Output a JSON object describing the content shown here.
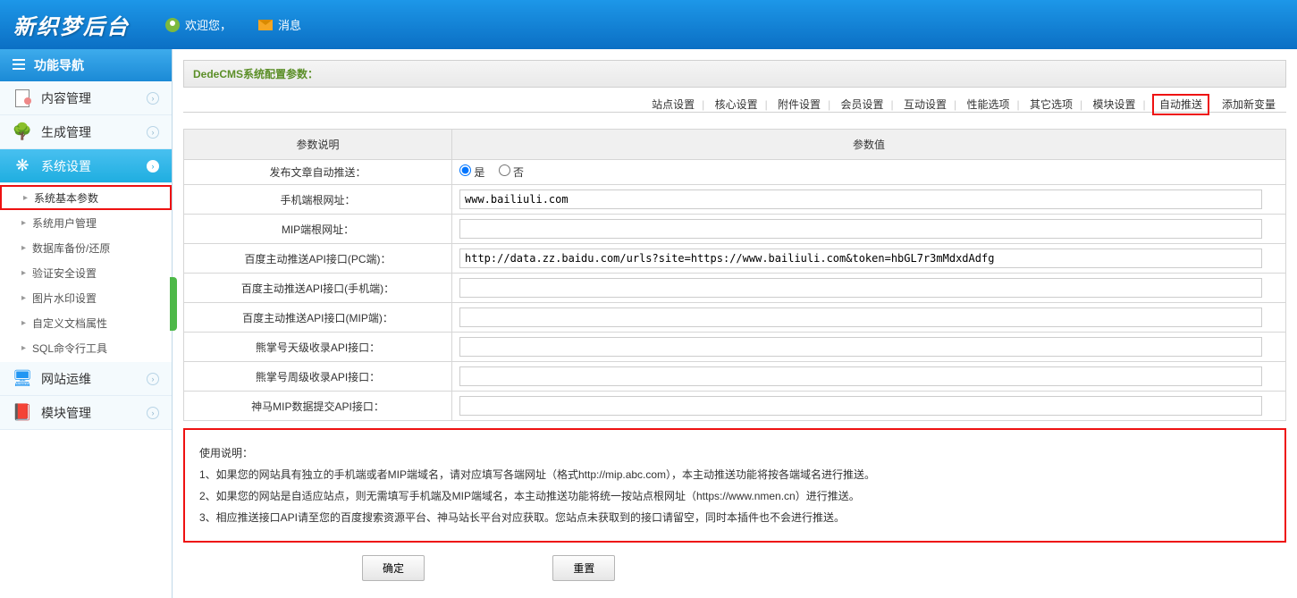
{
  "header": {
    "logo": "新织梦后台",
    "welcome": "欢迎您，",
    "messages": "消息"
  },
  "sidebar": {
    "nav_title": "功能导航",
    "items": [
      {
        "label": "内容管理",
        "icon": "doc"
      },
      {
        "label": "生成管理",
        "icon": "tree"
      },
      {
        "label": "系统设置",
        "icon": "gear",
        "active": true
      },
      {
        "label": "网站运维",
        "icon": "monitor"
      },
      {
        "label": "模块管理",
        "icon": "book"
      }
    ],
    "sub": [
      "系统基本参数",
      "系统用户管理",
      "数据库备份/还原",
      "验证安全设置",
      "图片水印设置",
      "自定义文档属性",
      "SQL命令行工具"
    ]
  },
  "main": {
    "breadcrumb": "DedeCMS系统配置参数：",
    "tabs": [
      "站点设置",
      "核心设置",
      "附件设置",
      "会员设置",
      "互动设置",
      "性能选项",
      "其它选项",
      "模块设置",
      "自动推送",
      "添加新变量"
    ],
    "table": {
      "th_label": "参数说明",
      "th_value": "参数值",
      "rows": [
        {
          "label": "发布文章自动推送：",
          "type": "radio",
          "yes": "是",
          "no": "否"
        },
        {
          "label": "手机端根网址：",
          "type": "text",
          "value": "www.bailiuli.com"
        },
        {
          "label": "MIP端根网址：",
          "type": "text",
          "value": ""
        },
        {
          "label": "百度主动推送API接口(PC端)：",
          "type": "text",
          "value": "http://data.zz.baidu.com/urls?site=https://www.bailiuli.com&token=hbGL7r3mMdxdAdfg"
        },
        {
          "label": "百度主动推送API接口(手机端)：",
          "type": "text",
          "value": ""
        },
        {
          "label": "百度主动推送API接口(MIP端)：",
          "type": "text",
          "value": ""
        },
        {
          "label": "熊掌号天级收录API接口：",
          "type": "text",
          "value": ""
        },
        {
          "label": "熊掌号周级收录API接口：",
          "type": "text",
          "value": ""
        },
        {
          "label": "神马MIP数据提交API接口：",
          "type": "text",
          "value": ""
        }
      ]
    },
    "info": {
      "title": "使用说明：",
      "line1": "1、如果您的网站具有独立的手机端或者MIP端域名，请对应填写各端网址（格式http://mip.abc.com），本主动推送功能将按各端域名进行推送。",
      "line2": "2、如果您的网站是自适应站点，则无需填写手机端及MIP端域名，本主动推送功能将统一按站点根网址（https://www.nmen.cn）进行推送。",
      "line3": "3、相应推送接口API请至您的百度搜索资源平台、神马站长平台对应获取。您站点未获取到的接口请留空，同时本插件也不会进行推送。"
    },
    "buttons": {
      "ok": "确定",
      "reset": "重置"
    }
  }
}
